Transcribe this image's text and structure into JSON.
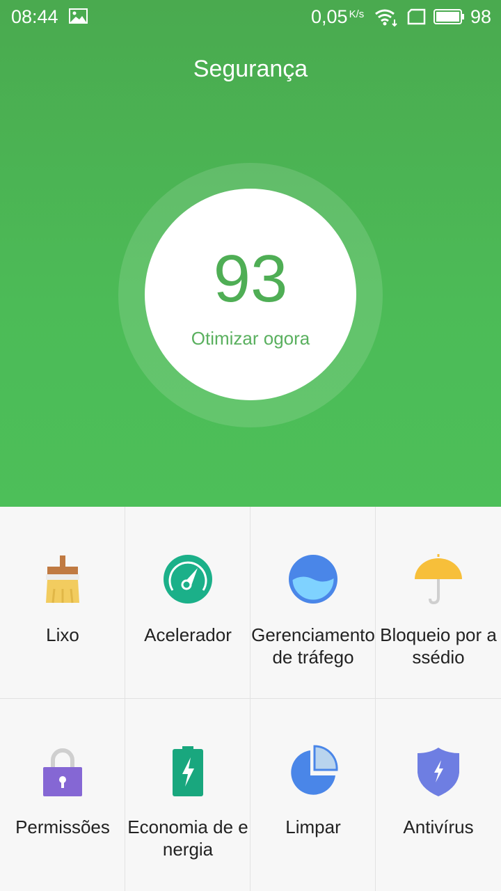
{
  "status_bar": {
    "time": "08:44",
    "net_speed": "0,05",
    "net_speed_unit": "K/s",
    "battery_level": "98",
    "icons": [
      "gallery-icon",
      "wifi-icon",
      "sim-icon",
      "battery-icon"
    ]
  },
  "header": {
    "title": "Segurança"
  },
  "score": {
    "value": "93",
    "action_label": "Otimizar ogora"
  },
  "colors": {
    "header_green": "#4cb556",
    "score_green": "#4fae55",
    "grid_bg": "#f7f7f7"
  },
  "tools": [
    {
      "label": "Lixo",
      "icon": "broom-icon"
    },
    {
      "label": "Acelerador",
      "icon": "speedometer-icon"
    },
    {
      "label": "Gerenciamento de tráfego",
      "icon": "traffic-globe-icon"
    },
    {
      "label": "Bloqueio por assédio",
      "icon": "umbrella-icon"
    },
    {
      "label": "Permissões",
      "icon": "lock-icon"
    },
    {
      "label": "Economia de energia",
      "icon": "battery-bolt-icon"
    },
    {
      "label": "Limpar",
      "icon": "pie-chart-icon"
    },
    {
      "label": "Antivírus",
      "icon": "shield-icon"
    }
  ]
}
